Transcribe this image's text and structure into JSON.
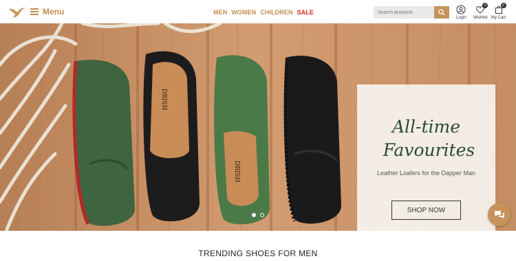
{
  "header": {
    "logo_icon": "bird-logo-icon",
    "menu_label": "Menu",
    "nav": [
      {
        "label": "MEN",
        "color": "#c38d4f"
      },
      {
        "label": "WOMEN",
        "color": "#c38d4f"
      },
      {
        "label": "CHILDREN",
        "color": "#c38d4f"
      },
      {
        "label": "SALE",
        "color": "#e0261b"
      }
    ],
    "search": {
      "placeholder": "Search products",
      "icon": "search-icon"
    },
    "login": {
      "label": "Login",
      "icon": "user-icon"
    },
    "wishlist": {
      "label": "Wishlist",
      "icon": "heart-icon",
      "count": "0"
    },
    "cart": {
      "label": "My Cart",
      "icon": "bag-icon",
      "count": "0"
    }
  },
  "hero": {
    "title_line1": "All-time",
    "title_line2": "Favourites",
    "subtitle": "Leather Loafers for the Dapper Man",
    "cta": "SHOP NOW",
    "shoe_brand": "DRISH",
    "slides": 2,
    "active_slide": 1
  },
  "chat": {
    "icon": "chat-icon"
  },
  "section": {
    "title": "TRENDING SHOES FOR MEN"
  },
  "colors": {
    "accent": "#c6935a",
    "sale": "#e0261b",
    "title_green": "#2a4a32"
  }
}
